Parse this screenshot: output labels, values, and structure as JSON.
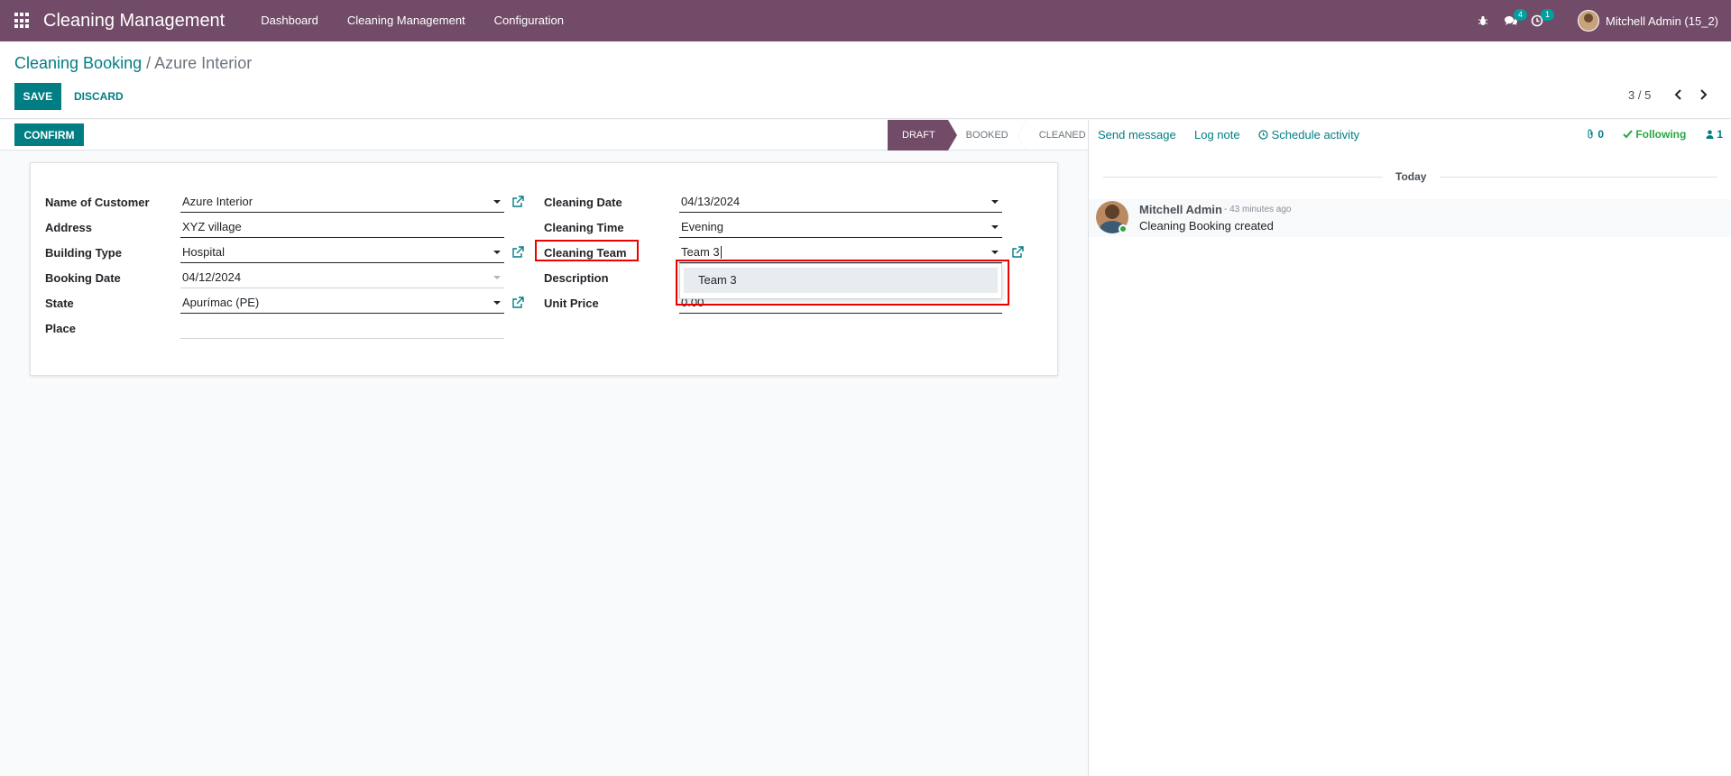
{
  "navbar": {
    "brand": "Cleaning Management",
    "menu": [
      "Dashboard",
      "Cleaning Management",
      "Configuration"
    ],
    "messages_badge": "4",
    "activity_badge": "1",
    "user": "Mitchell Admin (15_2)"
  },
  "control": {
    "breadcrumb_parent": "Cleaning Booking",
    "breadcrumb_sep": "/",
    "breadcrumb_current": "Azure Interior",
    "save_label": "SAVE",
    "discard_label": "DISCARD",
    "pager": "3 / 5"
  },
  "status": {
    "confirm_label": "CONFIRM",
    "stages": [
      "DRAFT",
      "BOOKED",
      "CLEANED"
    ],
    "active_stage": "DRAFT"
  },
  "form": {
    "left": [
      {
        "label": "Name of Customer",
        "value": "Azure Interior"
      },
      {
        "label": "Address",
        "value": "XYZ village"
      },
      {
        "label": "Building Type",
        "value": "Hospital"
      },
      {
        "label": "Booking Date",
        "value": "04/12/2024"
      },
      {
        "label": "State",
        "value": "Apurímac (PE)"
      },
      {
        "label": "Place",
        "value": ""
      }
    ],
    "right": [
      {
        "label": "Cleaning Date",
        "value": "04/13/2024"
      },
      {
        "label": "Cleaning Time",
        "value": "Evening"
      },
      {
        "label": "Cleaning Team",
        "value": "Team 3"
      },
      {
        "label": "Description",
        "value": ""
      },
      {
        "label": "Unit Price",
        "value": "0.00"
      }
    ],
    "dropdown_option": "Team 3"
  },
  "chatter": {
    "send_message": "Send message",
    "log_note": "Log note",
    "schedule_activity": "Schedule activity",
    "attachments": "0",
    "following": "Following",
    "followers": "1",
    "today": "Today",
    "message": {
      "author": "Mitchell Admin",
      "time": "- 43 minutes ago",
      "body": "Cleaning Booking created"
    }
  }
}
